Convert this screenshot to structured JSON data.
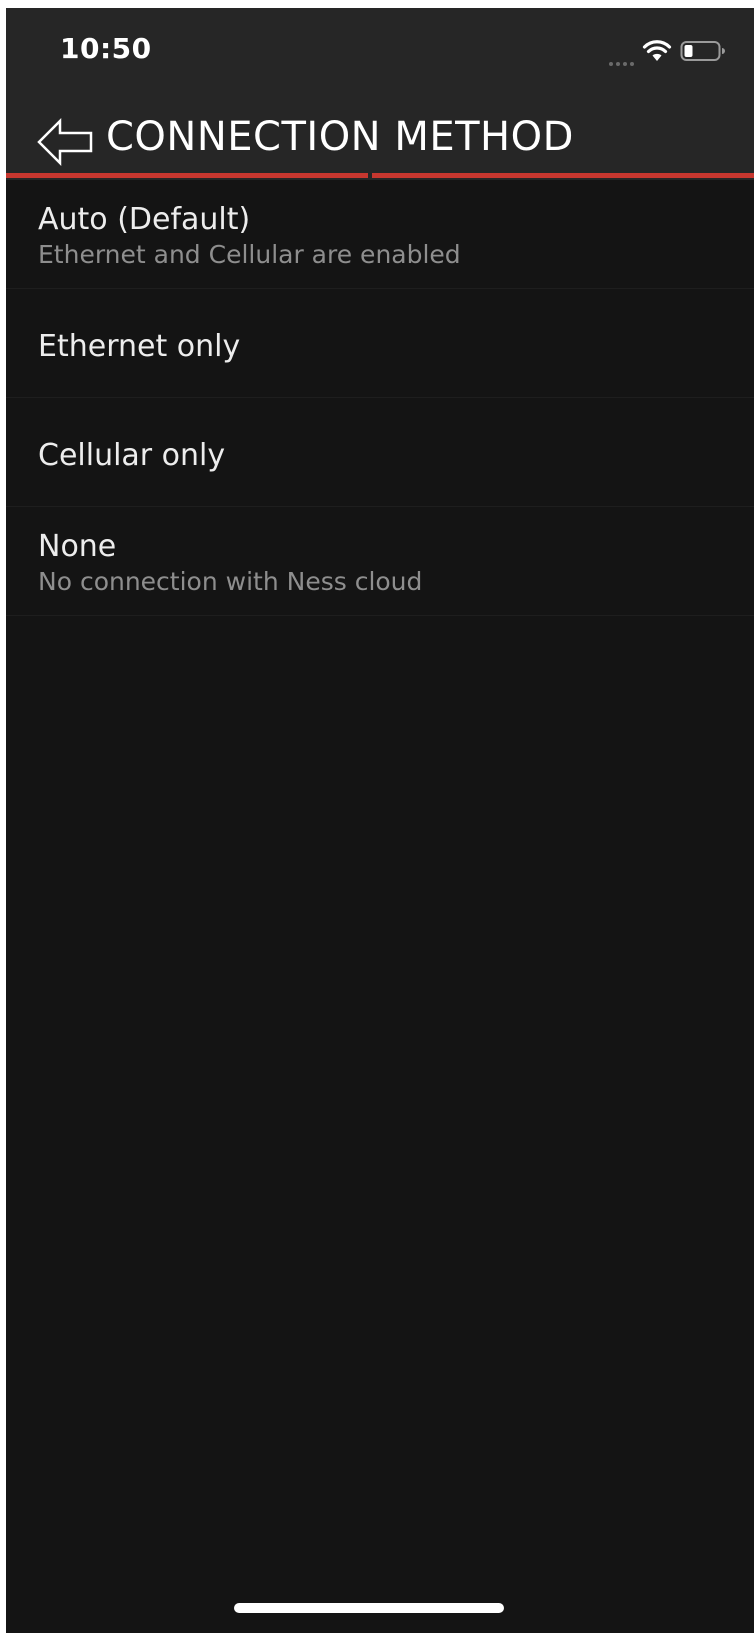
{
  "status_bar": {
    "time": "10:50",
    "icons": [
      "signal-dots-icon",
      "wifi-icon",
      "battery-icon"
    ]
  },
  "header": {
    "title": "CONNECTION METHOD",
    "back_icon": "back-arrow-icon"
  },
  "colors": {
    "accent": "#c7372f",
    "header_bg": "#262626",
    "content_bg": "#141414",
    "primary_text": "#ededed",
    "secondary_text": "#8e8e8e"
  },
  "options": [
    {
      "title": "Auto (Default)",
      "subtitle": "Ethernet and Cellular are enabled"
    },
    {
      "title": "Ethernet only"
    },
    {
      "title": "Cellular only"
    },
    {
      "title": "None",
      "subtitle": "No connection with Ness cloud"
    }
  ]
}
